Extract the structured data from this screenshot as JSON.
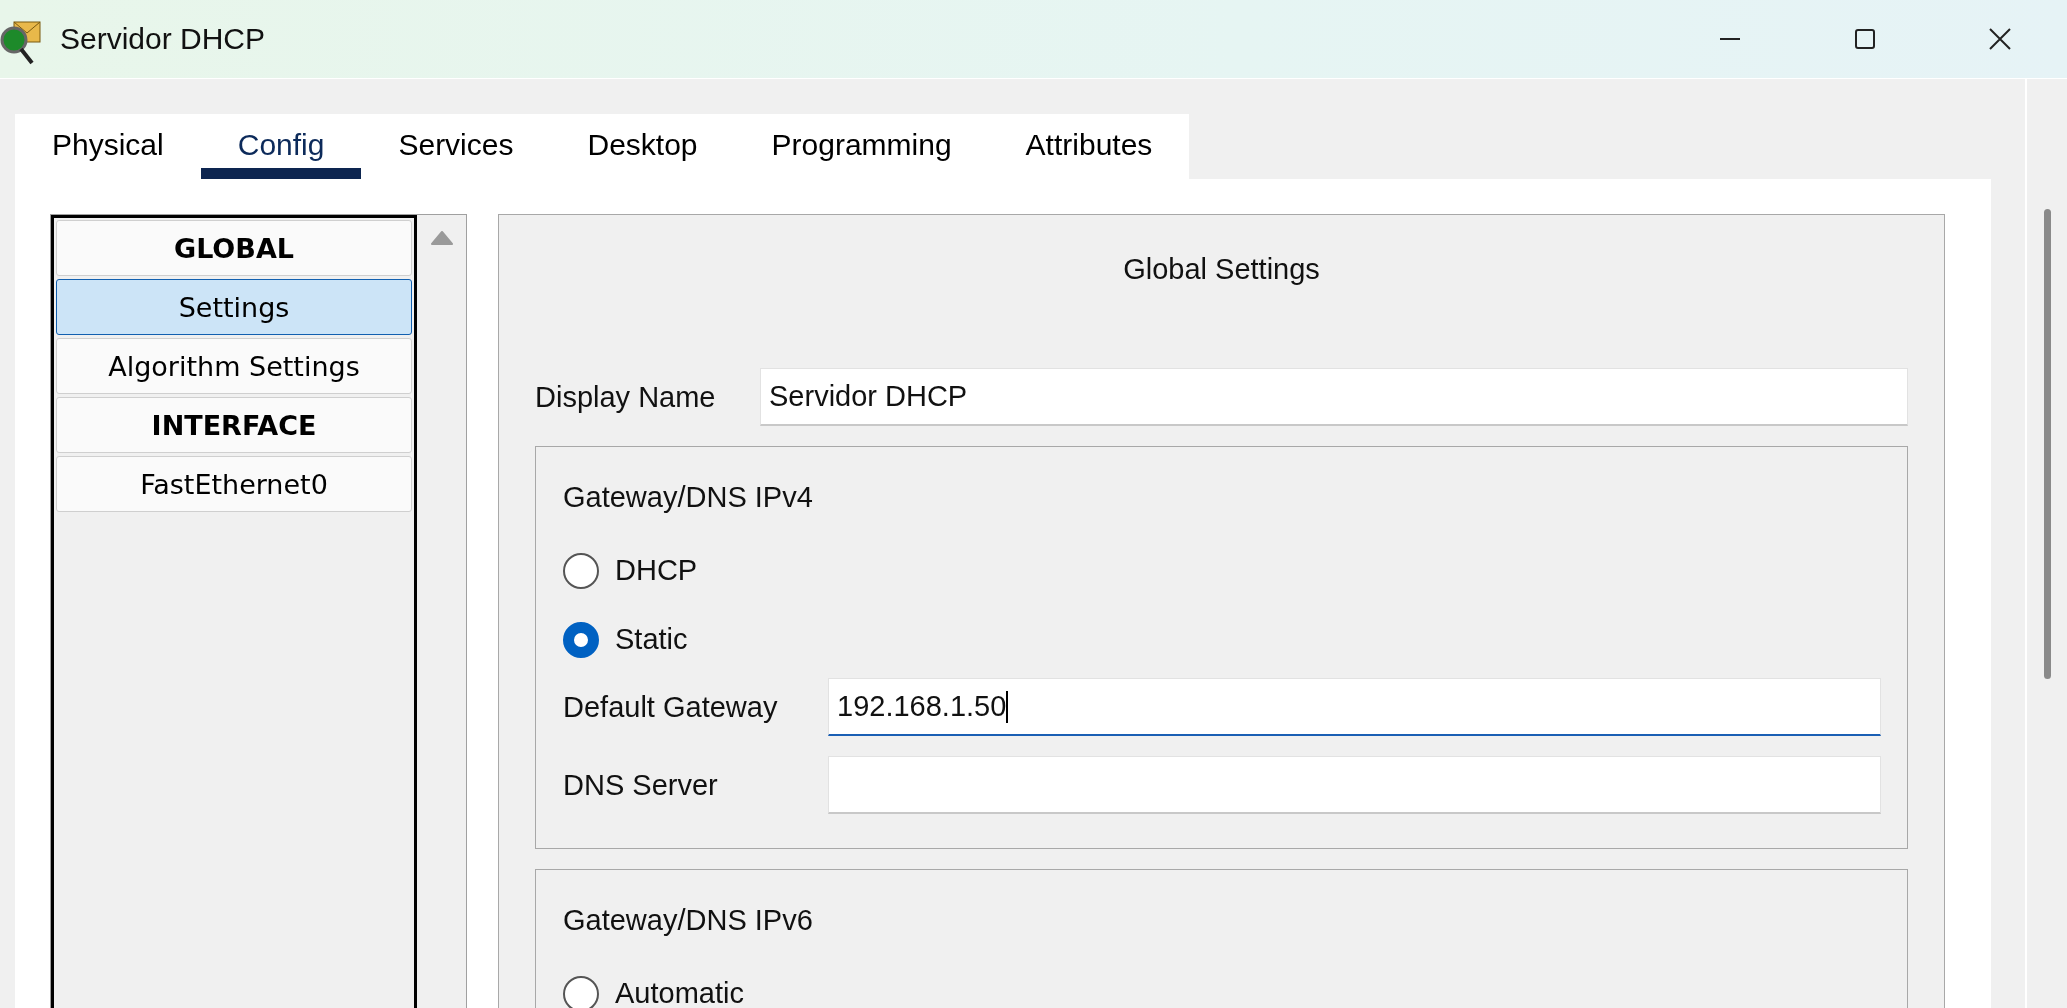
{
  "window": {
    "title": "Servidor DHCP"
  },
  "tabs": [
    {
      "label": "Physical",
      "selected": false
    },
    {
      "label": "Config",
      "selected": true
    },
    {
      "label": "Services",
      "selected": false
    },
    {
      "label": "Desktop",
      "selected": false
    },
    {
      "label": "Programming",
      "selected": false
    },
    {
      "label": "Attributes",
      "selected": false
    }
  ],
  "sidebar": {
    "items": [
      {
        "kind": "header",
        "label": "GLOBAL",
        "selected": false
      },
      {
        "kind": "item",
        "label": "Settings",
        "selected": true
      },
      {
        "kind": "item",
        "label": "Algorithm Settings",
        "selected": false
      },
      {
        "kind": "header",
        "label": "INTERFACE",
        "selected": false
      },
      {
        "kind": "item",
        "label": "FastEthernet0",
        "selected": false
      }
    ]
  },
  "panel": {
    "title": "Global Settings",
    "display_name": {
      "label": "Display Name",
      "value": "Servidor DHCP"
    },
    "ipv4": {
      "title": "Gateway/DNS IPv4",
      "options": [
        {
          "label": "DHCP",
          "selected": false
        },
        {
          "label": "Static",
          "selected": true
        }
      ],
      "fields": [
        {
          "label": "Default Gateway",
          "value": "192.168.1.50",
          "focused": true
        },
        {
          "label": "DNS Server",
          "focused": false
        }
      ]
    },
    "ipv6": {
      "title": "Gateway/DNS IPv6",
      "options": [
        {
          "label": "Automatic",
          "selected": false
        }
      ]
    }
  }
}
